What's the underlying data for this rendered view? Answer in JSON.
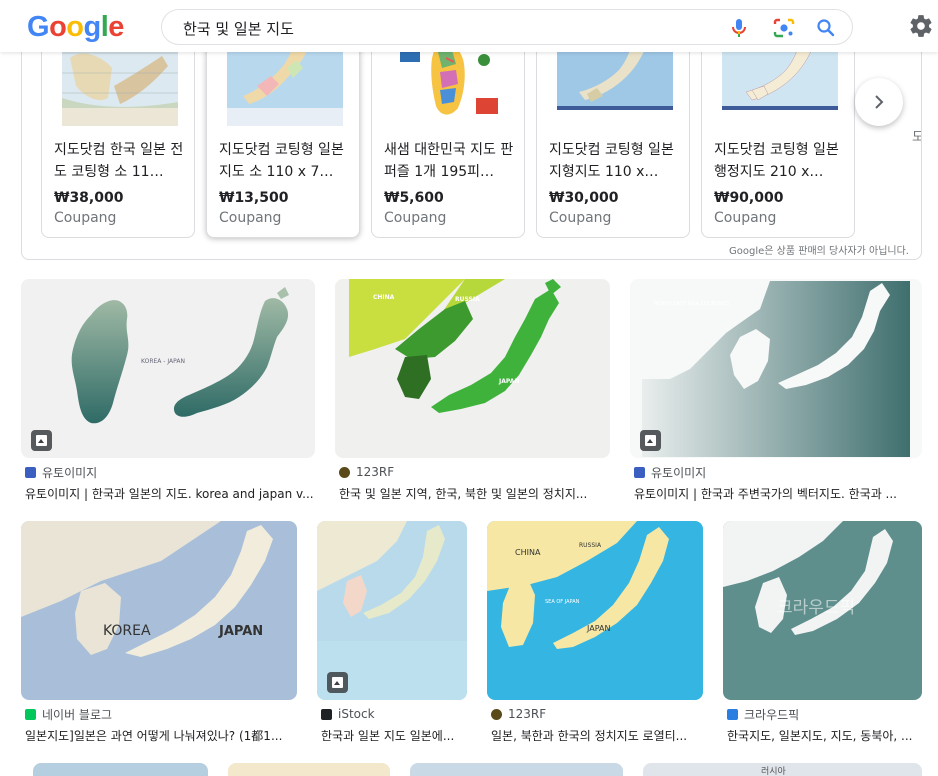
{
  "header": {
    "logo_letters": [
      {
        "ch": "G",
        "color": "#4285F4"
      },
      {
        "ch": "o",
        "color": "#EA4335"
      },
      {
        "ch": "o",
        "color": "#FBBC05"
      },
      {
        "ch": "g",
        "color": "#4285F4"
      },
      {
        "ch": "l",
        "color": "#34A853"
      },
      {
        "ch": "e",
        "color": "#EA4335"
      }
    ],
    "search_query": "한국 및 일본 지도",
    "icons": [
      "mic-icon",
      "lens-icon",
      "search-icon",
      "gear-icon"
    ]
  },
  "shopping": {
    "products": [
      {
        "title": "지도닷컴 한국 일본 전도 코팅형 소 11…",
        "price": "₩38,000",
        "store": "Coupang"
      },
      {
        "title": "지도닷컴 코팅형 일본 지도 소 110 x 7…",
        "price": "₩13,500",
        "store": "Coupang"
      },
      {
        "title": "새샘 대한민국 지도 판퍼즐 1개 195피…",
        "price": "₩5,600",
        "store": "Coupang"
      },
      {
        "title": "지도닷컴 코팅형 일본 지형지도 110 x…",
        "price": "₩30,000",
        "store": "Coupang"
      },
      {
        "title": "지도닷컴 코팅형 일본 행정지도 210 x…",
        "price": "₩90,000",
        "store": "Coupang"
      }
    ],
    "clipped_next": "도",
    "disclaimer": "Google은 상품 판매의 당사자가 아닙니다."
  },
  "images": {
    "row1": [
      {
        "source": "유토이미지",
        "caption": "유토이미지 | 한국과 일본의 지도. korea and japan v...",
        "map_label": "KOREA - JAPAN",
        "favicon_color": "#3b5fc0"
      },
      {
        "source": "123RF",
        "caption": "한국 및 일본 지역, 한국, 북한 및 일본의 정치지...",
        "map_labels": [
          "CHINA",
          "RUSSIA",
          "JAPAN"
        ],
        "favicon_color": "#5a4a1a"
      },
      {
        "source": "유토이미지",
        "caption": "유토이미지 | 한국과 주변국가의 벡터지도. 한국과 ...",
        "map_label": "NORTH EAST ASIA COUNTRIES",
        "favicon_color": "#3b5fc0"
      }
    ],
    "row2": [
      {
        "source": "네이버 블로그",
        "caption": "일본지도]일본은 과연 어떻게 나눠져있나? (1都1...",
        "map_labels": [
          "KOREA",
          "JAPAN"
        ],
        "favicon_color": "#03c75a"
      },
      {
        "source": "iStock",
        "caption": "한국과 일본 지도 일본에...",
        "favicon_color": "#202124"
      },
      {
        "source": "123RF",
        "caption": "일본, 북한과 한국의 정치지도 로열티...",
        "map_labels": [
          "CHINA",
          "RUSSIA",
          "JAPAN",
          "SEA OF JAPAN"
        ],
        "favicon_color": "#5a4a1a"
      },
      {
        "source": "크라우드픽",
        "caption": "한국지도, 일본지도, 지도, 동북아, ...",
        "watermark": "크라우드픽",
        "favicon_color": "#2a7de1"
      }
    ],
    "row3_clipped": [
      "러시아"
    ]
  },
  "colors": {
    "accent_blue": "#1a73e8",
    "text_secondary": "#70757a"
  }
}
